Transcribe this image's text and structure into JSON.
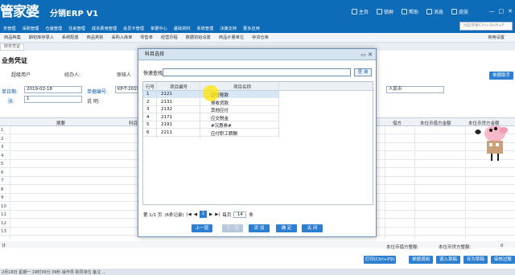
{
  "header": {
    "logo": "管家婆",
    "product": "分销ERP V1",
    "links": [
      "主页",
      "锁屏",
      "帮助",
      "消息",
      "皮肤"
    ],
    "search_placeholder": "功能搜索Ctrl+Shift+F"
  },
  "nav": {
    "items": [
      "务管理",
      "采购管理",
      "仓储管理",
      "往来管理",
      "成本费用管理",
      "会员卡管理",
      "单据中心",
      "基础资料",
      "系统管理",
      "决策支持",
      "更多应用"
    ]
  },
  "toolbar": {
    "items": [
      "商品档案",
      "期初库存录入",
      "系统配置",
      "商品类别",
      "采购入库单",
      "零售单",
      "经营历程",
      "数据初始设置",
      "商品计量单位",
      "存货仓库"
    ],
    "right": "常用设置"
  },
  "tab": {
    "label": "财务凭证"
  },
  "form": {
    "title": "业务凭证",
    "org_value": "超级用户",
    "handler_label": "经办人:",
    "approver_label": "审核人",
    "date_label": "单日期:",
    "date_value": "2019-02-18",
    "docno_label": "单据编号:",
    "docno_value": "KP-T-2019",
    "att_label": "张:",
    "att_value": "1",
    "note_label": "说    明:",
    "currency_value": "人民币",
    "help_button": "单据助手"
  },
  "grid": {
    "headers": [
      "摘要",
      "科目",
      "借方",
      "本位币借方金额",
      "本位币贷方金额"
    ],
    "rows": [
      "1",
      "2",
      "3",
      "4",
      "5",
      "6",
      "7",
      "8",
      "9",
      "10",
      "11",
      "12",
      "13"
    ],
    "footer_left": "计",
    "footer_right": [
      "本位币借方整额:",
      "本位币贷方整额:",
      "0"
    ]
  },
  "bottom_buttons": [
    "打印(Ctrl+P9)",
    "单据调阅",
    "调入草稿",
    "存为草稿",
    "审核过账(F8)"
  ],
  "status_bar": "2月18日 星期一 19时39分 39秒   操作员  职员单位   备注   ...",
  "dialog": {
    "title": "科目选择",
    "quick_label": "快速查找",
    "query_button": "查 询",
    "columns": [
      "行号",
      "项目编号",
      "项目名称"
    ],
    "rows": [
      {
        "no": "1",
        "code": "2121",
        "name": "应付账款"
      },
      {
        "no": "2",
        "code": "2131",
        "name": "预收货款"
      },
      {
        "no": "3",
        "code": "2132",
        "name": "其他应付"
      },
      {
        "no": "4",
        "code": "2171",
        "name": "应交税金"
      },
      {
        "no": "5",
        "code": "2191",
        "name": "#沉惠券#"
      },
      {
        "no": "6",
        "code": "2211",
        "name": "应付职工薪酬"
      }
    ],
    "pager": {
      "page": "第 1/1 页",
      "records": "(6条记录)",
      "current": "1",
      "size_label": "每页",
      "size": "14",
      "unit": "条"
    },
    "buttons": [
      "上一层",
      "下一层",
      "添 加",
      "确 定",
      "关 闭"
    ]
  },
  "colors": {
    "brand": "#0d6bb8",
    "accent": "#2d7fd0",
    "highlight": "#ffe600"
  }
}
